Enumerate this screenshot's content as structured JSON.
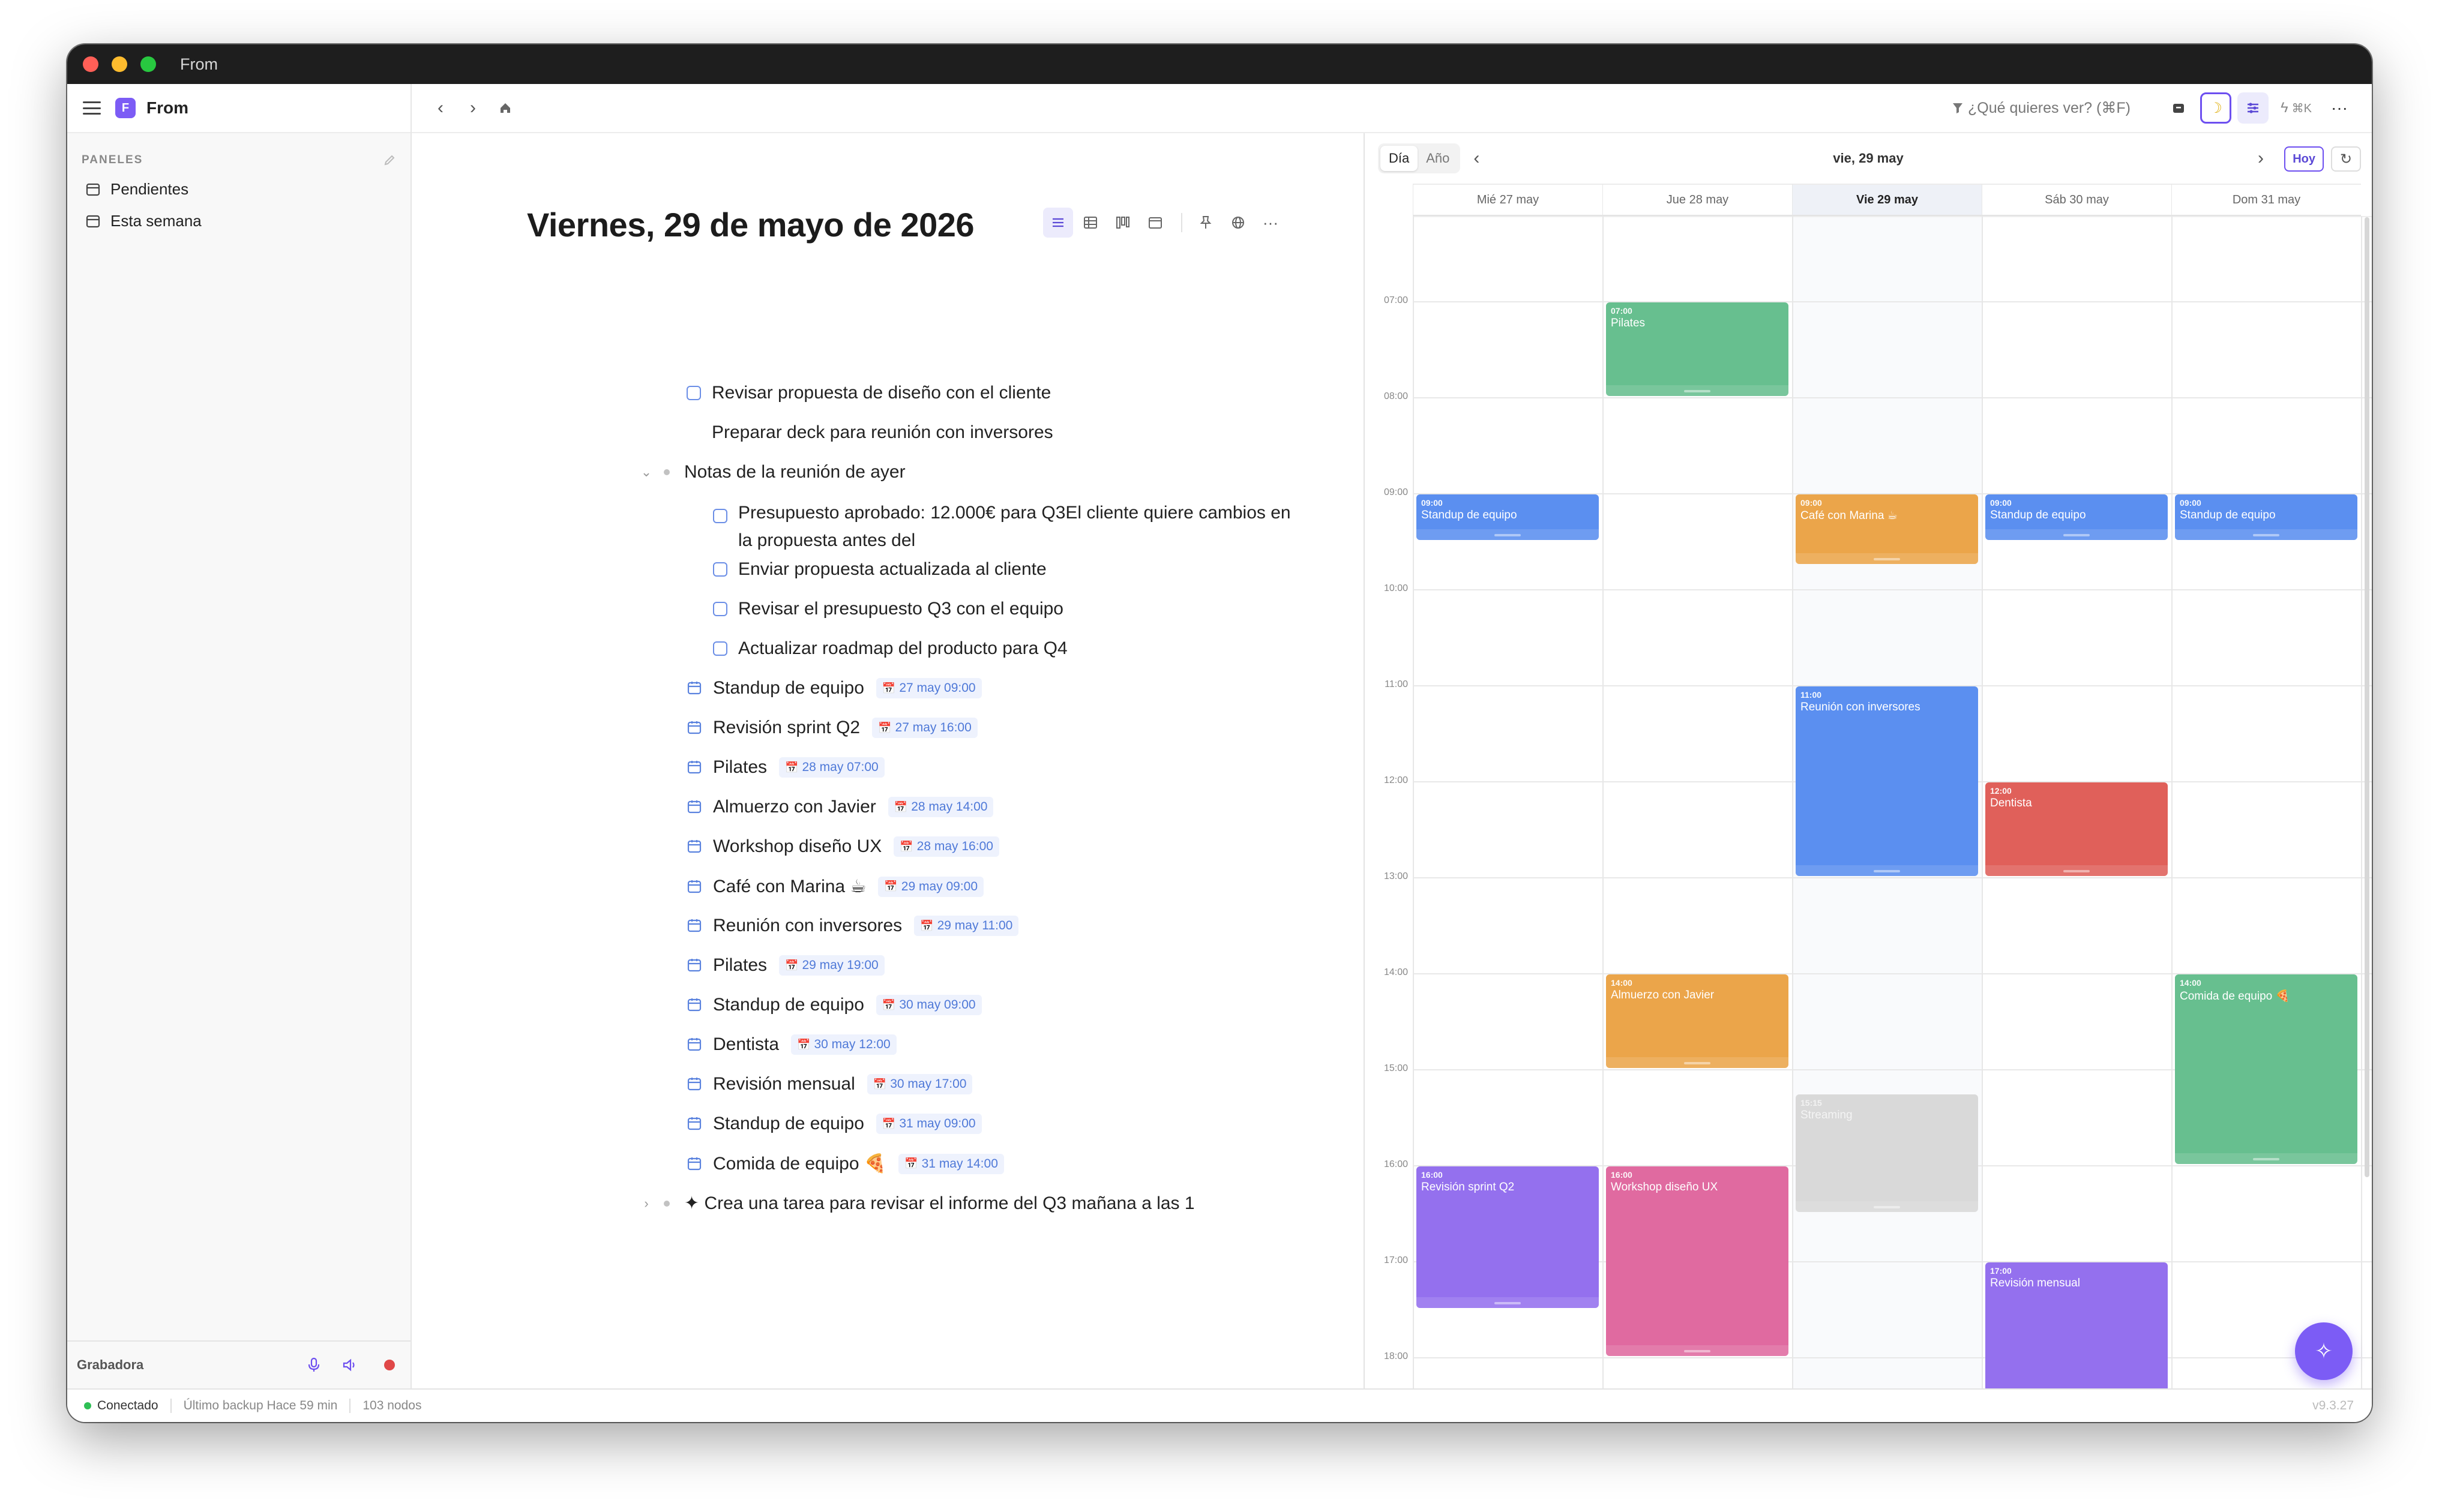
{
  "window": {
    "title": "From"
  },
  "sidebar": {
    "app_name": "From",
    "app_initial": "F",
    "section_label": "PANELES",
    "items": [
      {
        "label": "Pendientes"
      },
      {
        "label": "Esta semana"
      }
    ],
    "recorder_label": "Grabadora"
  },
  "topbar": {
    "search_placeholder": "¿Qué quieres ver? (⌘F)",
    "shortcut_label": "⌘K"
  },
  "editor": {
    "title": "Viernes, 29 de mayo de 2026",
    "rows": [
      {
        "type": "task",
        "text": "Revisar propuesta de diseño con el cliente"
      },
      {
        "type": "text",
        "text": "Preparar deck para reunión con inversores"
      },
      {
        "type": "group",
        "text": "Notas de la reunión de ayer"
      },
      {
        "type": "task",
        "text": "Presupuesto aprobado: 12.000€ para Q3El cliente quiere cambios en",
        "text2": "la propuesta antes del"
      },
      {
        "type": "task",
        "text": "Enviar propuesta actualizada al cliente"
      },
      {
        "type": "task",
        "text": "Revisar el presupuesto Q3 con el equipo"
      },
      {
        "type": "task",
        "text": "Actualizar roadmap del producto para Q4"
      },
      {
        "type": "event",
        "text": "Standup de equipo",
        "date": "27 may 09:00"
      },
      {
        "type": "event",
        "text": "Revisión sprint Q2",
        "date": "27 may 16:00"
      },
      {
        "type": "event",
        "text": "Pilates",
        "date": "28 may 07:00"
      },
      {
        "type": "event",
        "text": "Almuerzo con Javier",
        "date": "28 may 14:00"
      },
      {
        "type": "event",
        "text": "Workshop diseño UX",
        "date": "28 may 16:00"
      },
      {
        "type": "event",
        "text": "Café con Marina ☕",
        "date": "29 may 09:00"
      },
      {
        "type": "event",
        "text": "Reunión con inversores",
        "date": "29 may 11:00"
      },
      {
        "type": "event",
        "text": "Pilates",
        "date": "29 may 19:00"
      },
      {
        "type": "event",
        "text": "Standup de equipo",
        "date": "30 may 09:00"
      },
      {
        "type": "event",
        "text": "Dentista",
        "date": "30 may 12:00"
      },
      {
        "type": "event",
        "text": "Revisión mensual",
        "date": "30 may 17:00"
      },
      {
        "type": "event",
        "text": "Standup de equipo",
        "date": "31 may 09:00"
      },
      {
        "type": "event",
        "text": "Comida de equipo 🍕",
        "date": "31 may 14:00"
      },
      {
        "type": "group",
        "text": "✦ Crea una tarea para revisar el informe del Q3 mañana a las 1"
      }
    ]
  },
  "calendar": {
    "views": [
      "Día",
      "Año"
    ],
    "active_view": "Día",
    "title": "vie, 29 may",
    "today_button": "Hoy",
    "days": [
      "Mié 27 may",
      "Jue 28 may",
      "Vie 29 may",
      "Sáb 30 may",
      "Dom 31 may"
    ],
    "today_index": 2,
    "hours": [
      "07:00",
      "08:00",
      "09:00",
      "10:00",
      "11:00",
      "12:00",
      "13:00",
      "14:00",
      "15:00",
      "16:00",
      "17:00",
      "18:00"
    ],
    "events": [
      {
        "day": 1,
        "start": "07:00",
        "name": "Pilates",
        "duration_h": 1.0,
        "color": "#67bf8f"
      },
      {
        "day": 0,
        "start": "09:00",
        "name": "Standup de equipo",
        "duration_h": 0.5,
        "color": "#5b8ff0"
      },
      {
        "day": 2,
        "start": "09:00",
        "name": "Café con Marina ☕",
        "duration_h": 0.75,
        "color": "#eba54a"
      },
      {
        "day": 3,
        "start": "09:00",
        "name": "Standup de equipo",
        "duration_h": 0.5,
        "color": "#5b8ff0"
      },
      {
        "day": 4,
        "start": "09:00",
        "name": "Standup de equipo",
        "duration_h": 0.5,
        "color": "#5b8ff0"
      },
      {
        "day": 2,
        "start": "11:00",
        "name": "Reunión con inversores",
        "duration_h": 2.0,
        "color": "#5b8ff0"
      },
      {
        "day": 3,
        "start": "12:00",
        "name": "Dentista",
        "duration_h": 1.0,
        "color": "#e0605a"
      },
      {
        "day": 1,
        "start": "14:00",
        "name": "Almuerzo con Javier",
        "duration_h": 1.0,
        "color": "#eba54a"
      },
      {
        "day": 4,
        "start": "14:00",
        "name": "Comida de equipo 🍕",
        "duration_h": 2.0,
        "color": "#67bf8f"
      },
      {
        "day": 2,
        "start": "15:15",
        "name": "Streaming",
        "duration_h": 1.25,
        "color": "#d9d9d9"
      },
      {
        "day": 0,
        "start": "16:00",
        "name": "Revisión sprint Q2",
        "duration_h": 1.5,
        "color": "#9470ee"
      },
      {
        "day": 1,
        "start": "16:00",
        "name": "Workshop diseño UX",
        "duration_h": 2.0,
        "color": "#e06aa0"
      },
      {
        "day": 3,
        "start": "17:00",
        "name": "Revisión mensual",
        "duration_h": 1.5,
        "color": "#9470ee"
      }
    ]
  },
  "statusbar": {
    "connection": "Conectado",
    "backup": "Último backup Hace 59 min",
    "nodes": "103 nodos",
    "version": "v9.3.27"
  },
  "colors": {
    "accent": "#7c5cf5",
    "task_border": "#6b8ee6",
    "chip_bg": "#eef2fd",
    "chip_text": "#4f79d8"
  }
}
